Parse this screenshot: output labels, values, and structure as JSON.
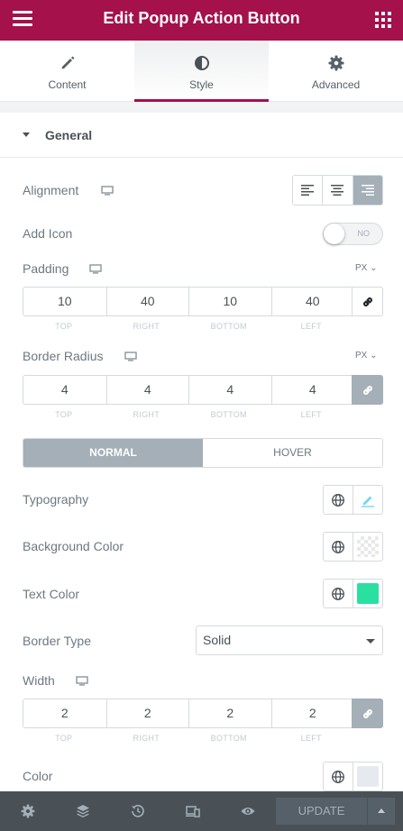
{
  "header": {
    "title": "Edit Popup Action Button"
  },
  "tabs": [
    {
      "label": "Content",
      "icon": "pencil-icon"
    },
    {
      "label": "Style",
      "icon": "half-circle-icon",
      "active": true
    },
    {
      "label": "Advanced",
      "icon": "gear-icon"
    }
  ],
  "section": {
    "title": "General",
    "expanded": true
  },
  "alignment": {
    "label": "Alignment",
    "options": [
      "left",
      "center",
      "right"
    ],
    "selected": "right"
  },
  "add_icon": {
    "label": "Add Icon",
    "toggle_text": "NO",
    "enabled": false
  },
  "padding": {
    "label": "Padding",
    "unit": "PX",
    "values": [
      "10",
      "40",
      "10",
      "40"
    ],
    "sides": [
      "TOP",
      "RIGHT",
      "BOTTOM",
      "LEFT"
    ],
    "linked": false
  },
  "border_radius": {
    "label": "Border Radius",
    "unit": "PX",
    "values": [
      "4",
      "4",
      "4",
      "4"
    ],
    "sides": [
      "TOP",
      "RIGHT",
      "BOTTOM",
      "LEFT"
    ],
    "linked": true
  },
  "state_tabs": {
    "normal": "NORMAL",
    "hover": "HOVER",
    "active": "normal"
  },
  "typography": {
    "label": "Typography"
  },
  "background_color": {
    "label": "Background Color",
    "value": "transparent"
  },
  "text_color": {
    "label": "Text Color",
    "value": "#2ae0a0"
  },
  "border_type": {
    "label": "Border Type",
    "value": "Solid"
  },
  "width": {
    "label": "Width",
    "values": [
      "2",
      "2",
      "2",
      "2"
    ],
    "sides": [
      "TOP",
      "RIGHT",
      "BOTTOM",
      "LEFT"
    ],
    "linked": true
  },
  "color": {
    "label": "Color",
    "value": "#e6e9f0"
  },
  "footer": {
    "update_label": "UPDATE"
  },
  "colors": {
    "brand": "#a4114b",
    "footer": "#495157",
    "active_control": "#a4afb7"
  }
}
